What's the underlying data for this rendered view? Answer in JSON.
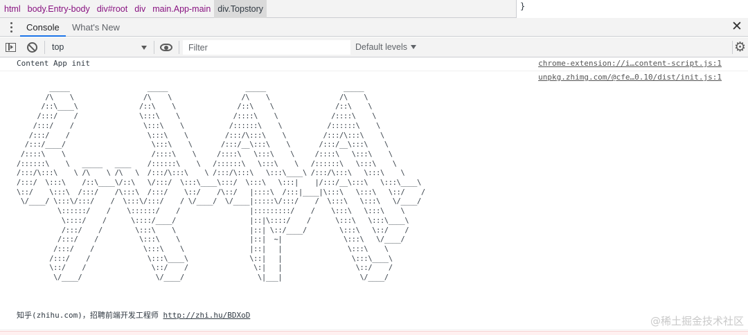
{
  "breadcrumbs": [
    "html",
    "body.Entry-body",
    "div#root",
    "div",
    "main.App-main",
    "div.Topstory"
  ],
  "styles_pane": {
    "text": "}"
  },
  "drawer": {
    "tabs": [
      {
        "label": "Console",
        "active": true
      },
      {
        "label": "What's New",
        "active": false
      }
    ]
  },
  "toolbar": {
    "context": "top",
    "filter_placeholder": "Filter",
    "filter_value": "",
    "levels": "Default levels"
  },
  "messages": [
    {
      "text": "Content App init",
      "source": "chrome-extension://i…content-script.js:1"
    },
    {
      "source": "unpkg.zhimg.com/@cfe…0.10/dist/init.js:1",
      "ascii_art": "        _____                   _____                   _____                   _____\n       /\\    \\                 /\\    \\                 /\\    \\                 /\\    \\\n      /::\\____\\               /::\\    \\               /::\\    \\               /::\\    \\\n     /:::/    /               \\:::\\    \\             /::::\\    \\             /::::\\    \\\n    /:::/    /                 \\:::\\    \\           /::::::\\    \\           /::::::\\    \\\n   /:::/    /                   \\:::\\    \\         /:::/\\:::\\    \\         /:::/\\:::\\    \\\n  /:::/____/                     \\:::\\    \\       /:::/__\\:::\\    \\       /:::/__\\:::\\    \\\n /::::\\    \\                     /::::\\    \\     /::::\\   \\:::\\    \\     /::::\\   \\:::\\    \\\n/::::::\\    \\   _____   ____    /::::::\\    \\   /::::::\\   \\:::\\    \\   /::::::\\   \\:::\\    \\\n/:::/\\:::\\    \\ /\\    \\ /\\   \\  /:::/\\:::\\    \\ /:::/\\:::\\   \\:::\\____\\ /:::/\\:::\\   \\:::\\    \\\n/:::/  \\:::\\    /::\\____\\/::\\   \\/:::/  \\:::\\____\\:::/  \\:::\\   \\:::|    |/:::/__\\:::\\   \\:::\\____\\\n\\::/    \\:::\\  /:::/    /\\:::\\  /:::/    \\::/    /\\::/   |::::\\  /:::|____|\\:::\\   \\:::\\   \\::/    /\n \\/____/ \\:::\\/:::/    /  \\:::\\/:::/    / \\/____/  \\/____|:::::\\/:::/    /  \\:::\\   \\:::\\   \\/____/\n          \\::::::/    /    \\::::::/    /                 |:::::::::/    /    \\:::\\   \\:::\\    \\\n           \\::::/    /      \\::::/____/                  |::|\\::::/    /      \\:::\\   \\:::\\____\\\n           /:::/    /        \\:::\\    \\                  |::| \\::/____/        \\:::\\   \\::/    /\n          /:::/    /          \\:::\\    \\                 |::|  ~|               \\:::\\   \\/____/\n         /:::/    /            \\:::\\    \\                |::|   |                \\:::\\    \\\n        /:::/    /              \\:::\\____\\               \\::|   |                 \\:::\\____\\\n        \\::/    /                \\::/    /                \\:|   |                  \\::/    /\n         \\/____/                  \\/____/                  \\|___|                   \\/____/",
      "footer_text": "知乎(zhihu.com)，招聘前端开发工程师",
      "footer_link": "http://zhi.hu/BDXoD"
    }
  ],
  "watermark": "@稀土掘金技术社区"
}
